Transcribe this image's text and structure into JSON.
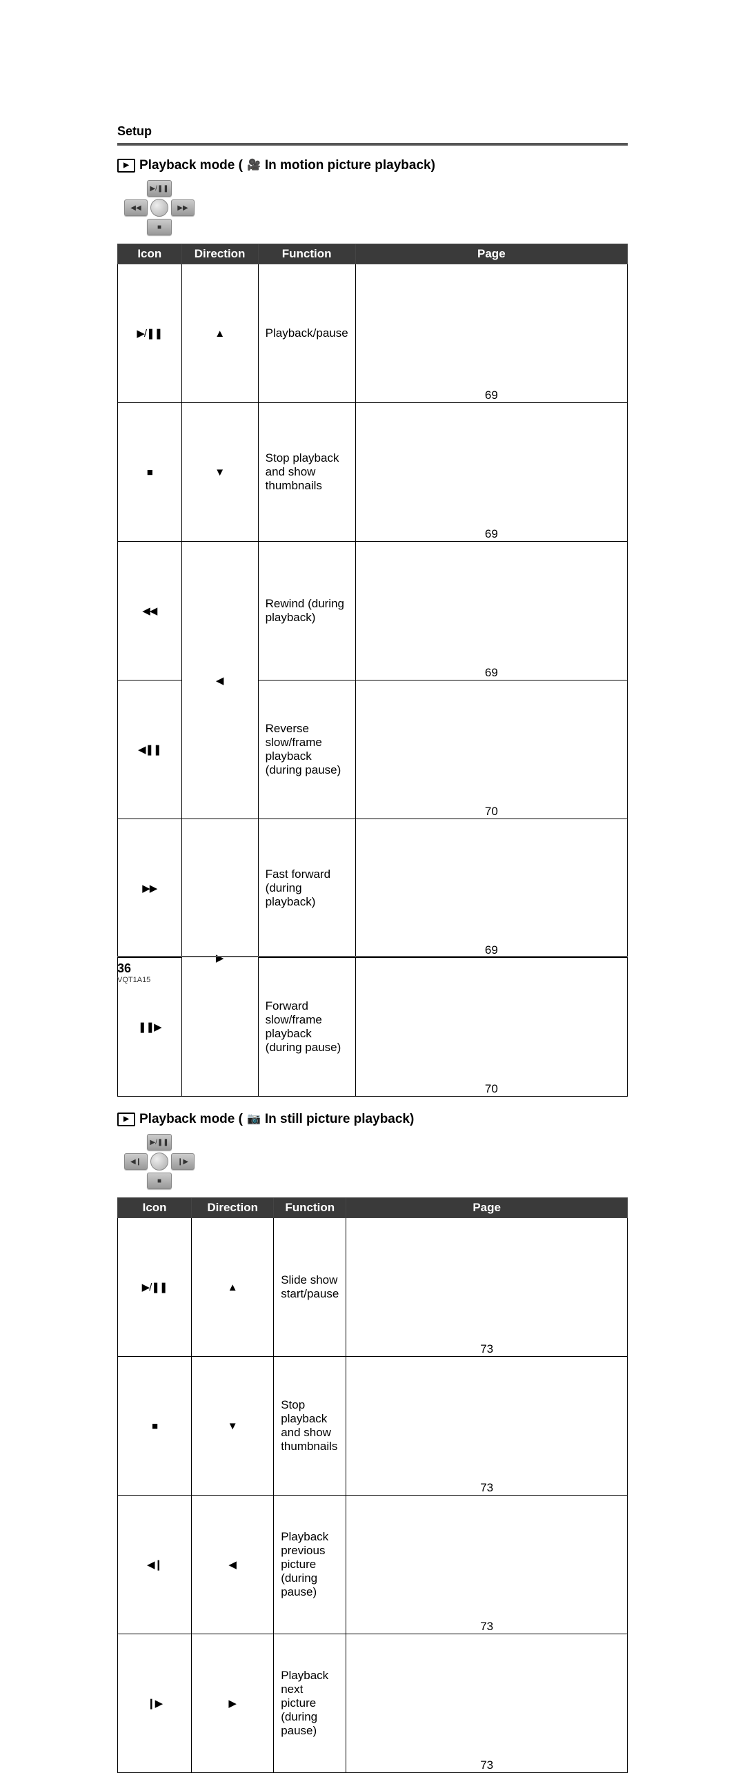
{
  "header": {
    "section": "Setup"
  },
  "section1": {
    "title_prefix": "Playback mode (",
    "title_suffix": "In motion picture playback)",
    "dpad": {
      "up": "▶/❚❚",
      "down": "■",
      "left": "◀◀",
      "right": "▶▶"
    },
    "columns": {
      "icon": "Icon",
      "direction": "Direction",
      "function": "Function",
      "page": "Page"
    },
    "rows": [
      {
        "icon": "▶/❚❚",
        "dir": "▲",
        "func": "Playback/pause",
        "page": "69"
      },
      {
        "icon": "■",
        "dir": "▼",
        "func": "Stop playback and show thumbnails",
        "page": "69"
      },
      {
        "icon": "◀◀",
        "dir": "◀",
        "func": "Rewind (during playback)",
        "page": "69",
        "dir_rowspan": 2
      },
      {
        "icon": "◀❚❚",
        "func": "Reverse slow/frame playback (during pause)",
        "page": "70"
      },
      {
        "icon": "▶▶",
        "dir": "▶",
        "func": "Fast forward (during playback)",
        "page": "69",
        "dir_rowspan": 2
      },
      {
        "icon": "❚❚▶",
        "func": "Forward slow/frame playback (during pause)",
        "page": "70"
      }
    ]
  },
  "section2": {
    "title_prefix": "Playback mode (",
    "title_suffix": "In still picture playback)",
    "dpad": {
      "up": "▶/❚❚",
      "down": "■",
      "left": "◀❙",
      "right": "❙▶"
    },
    "columns": {
      "icon": "Icon",
      "direction": "Direction",
      "function": "Function",
      "page": "Page"
    },
    "rows": [
      {
        "icon": "▶/❚❚",
        "dir": "▲",
        "func": "Slide show start/pause",
        "page": "73"
      },
      {
        "icon": "■",
        "dir": "▼",
        "func": "Stop playback and show thumbnails",
        "page": "73"
      },
      {
        "icon": "◀❙",
        "dir": "◀",
        "func": "Playback previous picture (during pause)",
        "page": "73"
      },
      {
        "icon": "❙▶",
        "dir": "▶",
        "func": "Playback next picture (during pause)",
        "page": "73"
      }
    ]
  },
  "footer": {
    "page_number": "36",
    "doc_id": "VQT1A15"
  }
}
